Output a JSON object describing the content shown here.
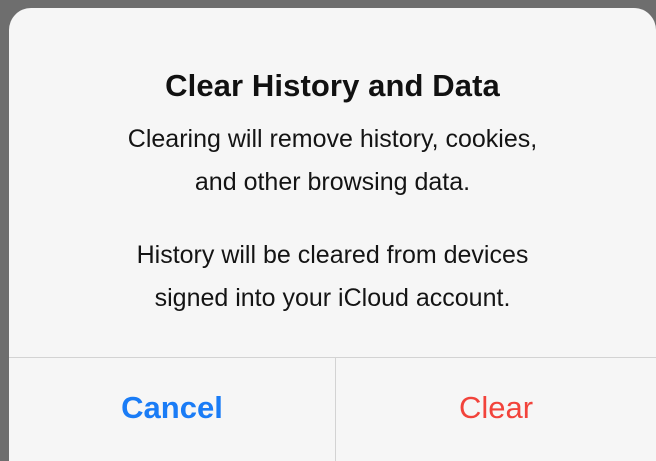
{
  "alert": {
    "title": "Clear History and Data",
    "message_paragraph_1": [
      "Clearing will remove history, cookies,",
      "and other browsing data."
    ],
    "message_paragraph_2": [
      "History will be cleared from devices",
      "signed into your iCloud account."
    ],
    "buttons": {
      "cancel_label": "Cancel",
      "clear_label": "Clear"
    }
  },
  "colors": {
    "cancel_button": "#1a7cf6",
    "clear_button": "#f2433b",
    "alert_background": "#f6f6f6",
    "backdrop": "#6e6e6e",
    "separator": "#d3d3d3"
  }
}
